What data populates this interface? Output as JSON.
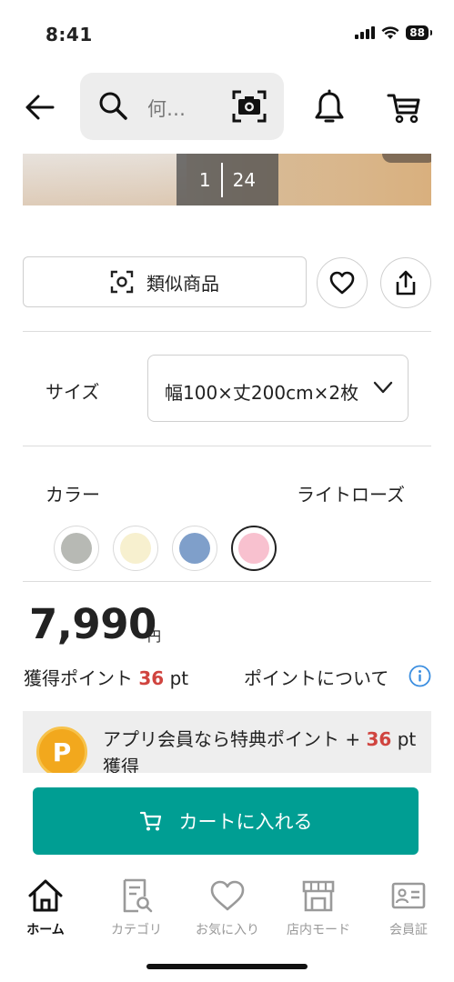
{
  "status_bar": {
    "time": "8:41",
    "battery": "88"
  },
  "header": {
    "search_placeholder": "何…"
  },
  "gallery": {
    "current": "1",
    "total": "24"
  },
  "actions": {
    "similar_label": "類似商品"
  },
  "size": {
    "label": "サイズ",
    "value": "幅100×丈200cm×2枚"
  },
  "color": {
    "label": "カラー",
    "selected": "ライトローズ",
    "swatches": [
      "#b7b9b4",
      "#f7f0cf",
      "#7f9fca",
      "#f8c1cf"
    ]
  },
  "price": {
    "amount": "7,990",
    "unit": "円"
  },
  "points": {
    "label": "獲得ポイント",
    "value": "36",
    "unit": "pt",
    "link": "ポイントについて"
  },
  "promo": {
    "badge": "P",
    "text_prefix": "アプリ会員なら特典ポイント + ",
    "value": "36",
    "text_suffix": "pt 獲得"
  },
  "cart_button": {
    "label": "カートに入れる"
  },
  "tabbar": {
    "items": [
      {
        "label": "ホーム",
        "icon": "home-icon"
      },
      {
        "label": "カテゴリ",
        "icon": "category-icon"
      },
      {
        "label": "お気に入り",
        "icon": "heart-icon"
      },
      {
        "label": "店内モード",
        "icon": "store-icon"
      },
      {
        "label": "会員証",
        "icon": "member-card-icon"
      }
    ]
  },
  "colors": {
    "accent": "#009e93",
    "point_red": "#d0443f",
    "badge_orange": "#f2a81d",
    "info_blue": "#3b8ee0"
  }
}
